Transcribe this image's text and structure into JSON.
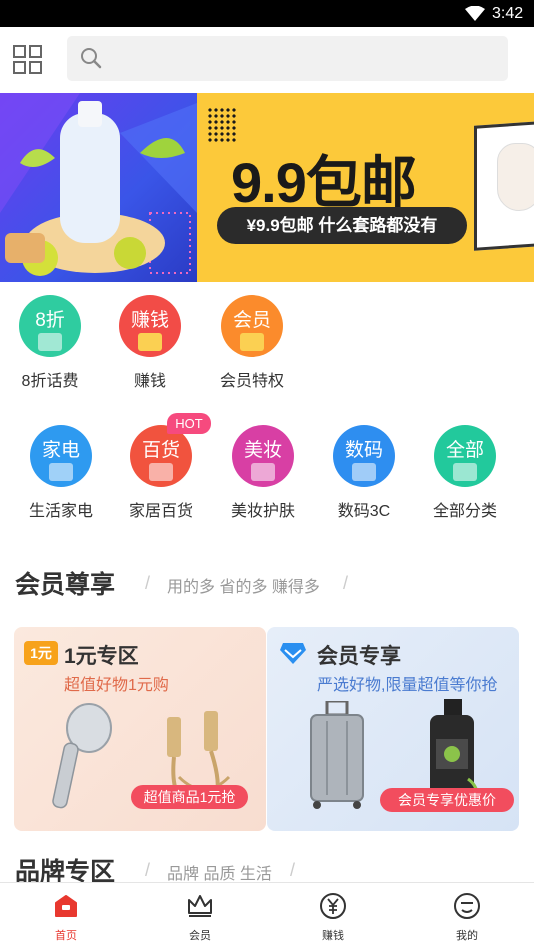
{
  "status_bar": {
    "time": "3:42"
  },
  "search": {
    "placeholder": ""
  },
  "banner": {
    "title": "9.9包邮",
    "subtitle": "¥9.9包邮 什么套路都没有"
  },
  "quick_entries": [
    {
      "circle_text": "8折",
      "label": "8折话费",
      "color": "#2fcca0"
    },
    {
      "circle_text": "赚钱",
      "label": "赚钱",
      "color": "#f24c47"
    },
    {
      "circle_text": "会员",
      "label": "会员特权",
      "color": "#fb8b2c"
    }
  ],
  "categories": [
    {
      "circle_text": "家电",
      "label": "生活家电",
      "color": "#2e9af0"
    },
    {
      "circle_text": "百货",
      "label": "家居百货",
      "color": "#f1533e"
    },
    {
      "circle_text": "美妆",
      "label": "美妆护肤",
      "color": "#d83fa4"
    },
    {
      "circle_text": "数码",
      "label": "数码3C",
      "color": "#2e8ef0"
    },
    {
      "circle_text": "全部",
      "label": "全部分类",
      "color": "#22c99c"
    }
  ],
  "hot_badge": "HOT",
  "member_section": {
    "title": "会员尊享",
    "subtitle": "用的多 省的多 赚得多"
  },
  "promo_left": {
    "badge": "1元",
    "title": "1元专区",
    "subtitle": "超值好物1元购",
    "pill": "超值商品1元抢"
  },
  "promo_right": {
    "title": "会员专享",
    "subtitle": "严选好物,限量超值等你抢",
    "pill": "会员专享优惠价"
  },
  "brand_section": {
    "title": "品牌专区",
    "subtitle": "品牌 品质 生活"
  },
  "tabs": [
    {
      "label": "首页",
      "active": true
    },
    {
      "label": "会员",
      "active": false
    },
    {
      "label": "赚钱",
      "active": false
    },
    {
      "label": "我的",
      "active": false
    }
  ],
  "colors": {
    "accent": "#e8382f",
    "pill": "#f24d5e",
    "banner_bg": "#fcc93a"
  }
}
